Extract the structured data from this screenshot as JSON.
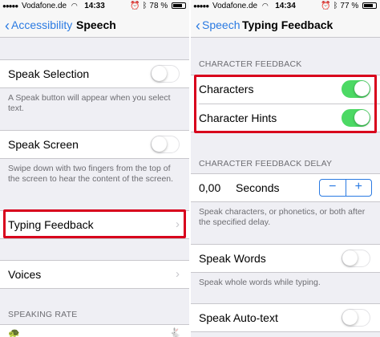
{
  "left": {
    "status": {
      "carrier": "Vodafone.de",
      "time": "14:33",
      "battery": "78 %",
      "battery_level": 0.78
    },
    "nav": {
      "back_label": "Accessibility",
      "title": "Speech"
    },
    "speak_selection": {
      "label": "Speak Selection",
      "on": false,
      "footer": "A Speak button will appear when you select text."
    },
    "speak_screen": {
      "label": "Speak Screen",
      "on": false,
      "footer": "Swipe down with two fingers from the top of the screen to hear the content of the screen."
    },
    "typing_feedback": {
      "label": "Typing Feedback"
    },
    "voices": {
      "label": "Voices"
    },
    "speaking_rate_header": "SPEAKING RATE"
  },
  "right": {
    "status": {
      "carrier": "Vodafone.de",
      "time": "14:34",
      "battery": "77 %",
      "battery_level": 0.77
    },
    "nav": {
      "back_label": "Speech",
      "title": "Typing Feedback"
    },
    "character_feedback_header": "CHARACTER FEEDBACK",
    "characters": {
      "label": "Characters",
      "on": true
    },
    "character_hints": {
      "label": "Character Hints",
      "on": true
    },
    "delay_header": "CHARACTER FEEDBACK DELAY",
    "delay": {
      "value": "0,00",
      "unit": "Seconds",
      "minus": "−",
      "plus": "+"
    },
    "delay_footer": "Speak characters, or phonetics, or both after the specified delay.",
    "speak_words": {
      "label": "Speak Words",
      "on": false,
      "footer": "Speak whole words while typing."
    },
    "speak_autotext": {
      "label": "Speak Auto-text",
      "on": false
    }
  },
  "colors": {
    "accent": "#2a7ae2",
    "toggle_on": "#4cd964",
    "highlight": "#d8001c"
  }
}
